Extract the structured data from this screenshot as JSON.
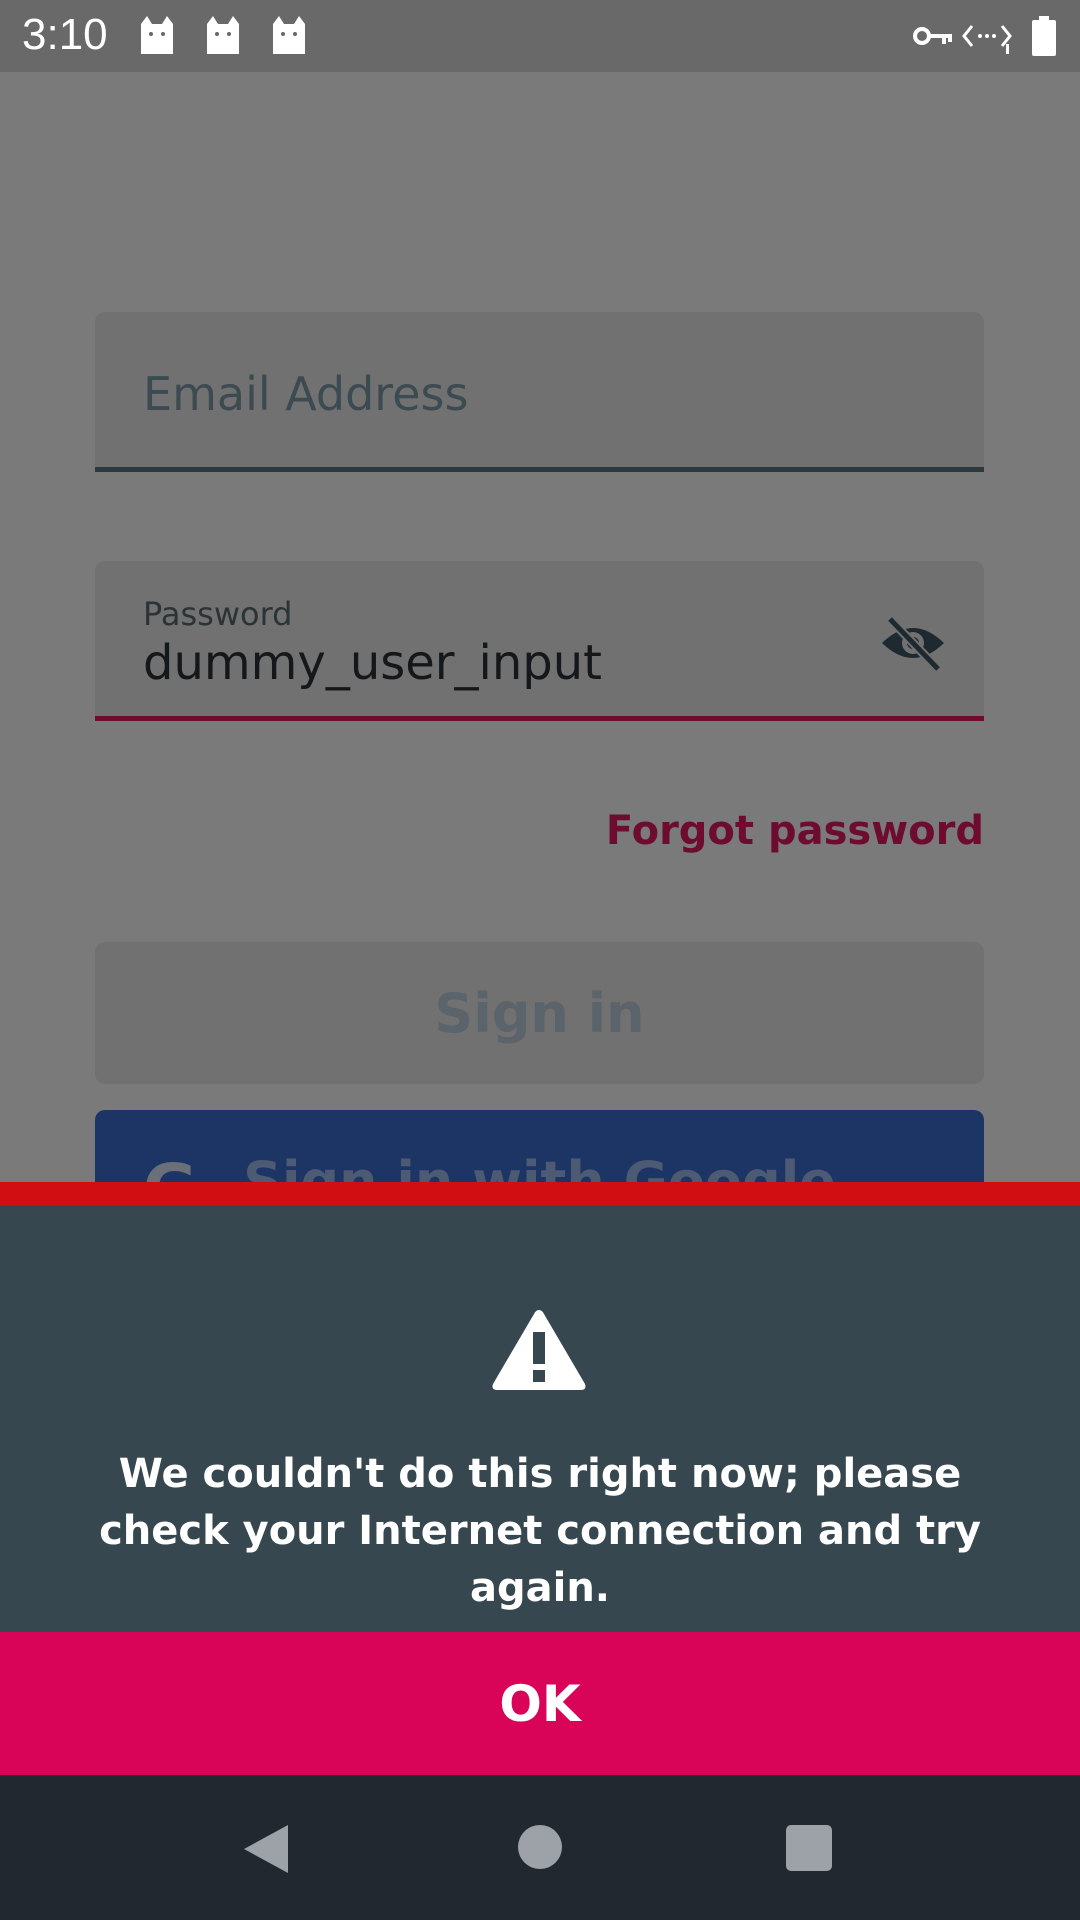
{
  "status_bar": {
    "time": "3:10",
    "notification_icons": [
      "cat-icon",
      "cat-icon",
      "cat-icon"
    ],
    "right_icons": [
      "vpn-key-icon",
      "data-arrows-icon",
      "battery-icon"
    ]
  },
  "login": {
    "email_placeholder": "Email Address",
    "password_label": "Password",
    "password_value": "dummy_user_input",
    "forgot_password": "Forgot password",
    "sign_in": "Sign in",
    "google_icon": "G",
    "sign_in_google": "Sign in with Google"
  },
  "dialog": {
    "message": "We couldn't do this right now; please check your Internet connection and try again.",
    "ok": "OK",
    "stripe_color": "#d10f12",
    "body_color": "#37474f",
    "button_color": "#d90357"
  },
  "colors": {
    "accent": "#6e0c30",
    "google_blue": "#1d3565"
  }
}
